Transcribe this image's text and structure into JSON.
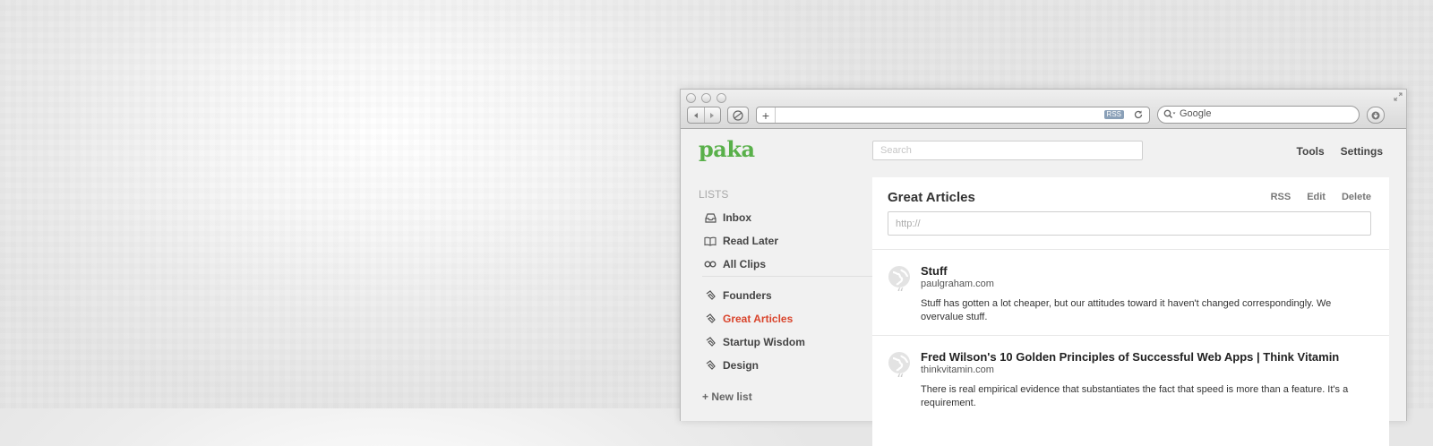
{
  "browser": {
    "rss_badge": "RSS",
    "search_engine": "Google",
    "new_tab_symbol": "+"
  },
  "app": {
    "logo": "paka",
    "search_placeholder": "Search",
    "nav": {
      "tools": "Tools",
      "settings": "Settings"
    }
  },
  "sidebar": {
    "heading": "LISTS",
    "items": [
      {
        "label": "Inbox",
        "icon": "inbox-icon"
      },
      {
        "label": "Read Later",
        "icon": "book-icon"
      },
      {
        "label": "All Clips",
        "icon": "infinity-icon"
      },
      {
        "label": "Founders",
        "icon": "paperclip-icon"
      },
      {
        "label": "Great Articles",
        "icon": "paperclip-icon",
        "active": true
      },
      {
        "label": "Startup Wisdom",
        "icon": "paperclip-icon"
      },
      {
        "label": "Design",
        "icon": "paperclip-icon"
      }
    ],
    "new_list": "+ New list"
  },
  "list": {
    "title": "Great Articles",
    "actions": {
      "rss": "RSS",
      "edit": "Edit",
      "delete": "Delete"
    },
    "url_placeholder": "http://"
  },
  "articles": [
    {
      "title": "Stuff",
      "domain": "paulgraham.com",
      "quote": "Stuff has gotten a lot cheaper, but our attitudes toward it haven't changed correspondingly. We overvalue stuff."
    },
    {
      "title": "Fred Wilson's 10 Golden Principles of Successful Web Apps | Think Vitamin",
      "domain": "thinkvitamin.com",
      "quote": "There is real empirical evidence that substantiates the fact that speed is more than a feature. It's a requirement."
    }
  ],
  "colors": {
    "accent_green": "#59b04a",
    "active_red": "#d9442c"
  }
}
